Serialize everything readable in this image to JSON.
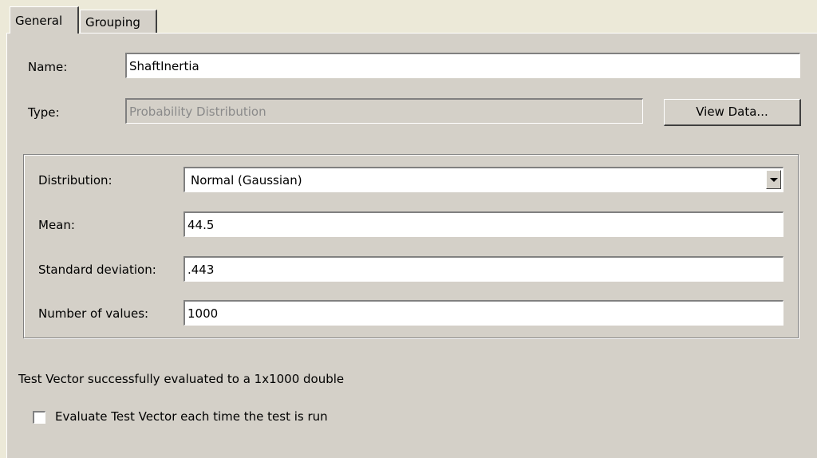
{
  "tabs": {
    "general": "General",
    "grouping": "Grouping"
  },
  "name": {
    "label": "Name:",
    "value": "ShaftInertia"
  },
  "type": {
    "label": "Type:",
    "value": "Probability Distribution",
    "button": "View Data..."
  },
  "distribution": {
    "label": "Distribution:",
    "selected": "Normal (Gaussian)"
  },
  "mean": {
    "label": "Mean:",
    "value": "44.5"
  },
  "std": {
    "label": "Standard deviation:",
    "value": ".443"
  },
  "count": {
    "label": "Number of values:",
    "value": "1000"
  },
  "status": {
    "text": "Test Vector successfully evaluated to a 1x1000 double"
  },
  "evaluate": {
    "label": "Evaluate Test Vector each time the test is run",
    "checked": false
  },
  "colors": {
    "face": "#d4d0c8",
    "window": "#ffffff",
    "shadow": "#808080",
    "disabled_text": "#8a8a8a"
  },
  "icons": {
    "dropdown": "chevron-down-icon"
  }
}
